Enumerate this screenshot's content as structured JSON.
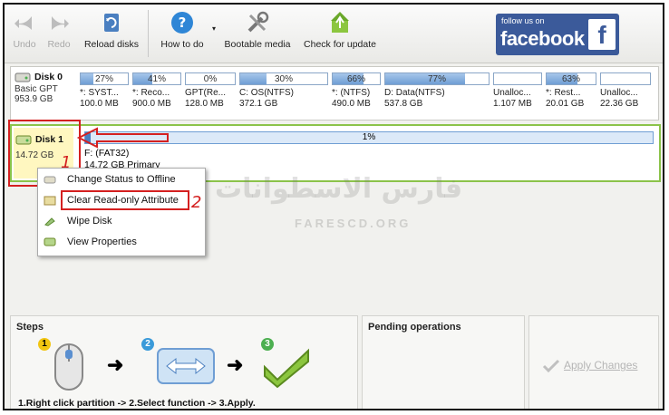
{
  "toolbar": {
    "undo": "Undo",
    "redo": "Redo",
    "reload": "Reload disks",
    "howto": "How to do",
    "bootable": "Bootable media",
    "update": "Check for update"
  },
  "facebook": {
    "small": "follow us on",
    "big": "facebook",
    "f": "f"
  },
  "disk0": {
    "name": "Disk 0",
    "type": "Basic GPT",
    "size": "953.9 GB",
    "partitions": [
      {
        "pct": "27%",
        "fill": 0.27,
        "name": "*: SYST...",
        "size": "100.0 MB"
      },
      {
        "pct": "41%",
        "fill": 0.41,
        "name": "*: Reco...",
        "size": "900.0 MB"
      },
      {
        "pct": "0%",
        "fill": 0.0,
        "name": "GPT(Re...",
        "size": "128.0 MB"
      },
      {
        "pct": "30%",
        "fill": 0.3,
        "name": "C: OS(NTFS)",
        "size": "372.1 GB"
      },
      {
        "pct": "66%",
        "fill": 0.66,
        "name": "*: (NTFS)",
        "size": "490.0 MB"
      },
      {
        "pct": "77%",
        "fill": 0.77,
        "name": "D: Data(NTFS)",
        "size": "537.8 GB"
      },
      {
        "pct": "",
        "fill": 0.0,
        "name": "Unalloc...",
        "size": "1.107 MB"
      },
      {
        "pct": "63%",
        "fill": 0.63,
        "name": "*: Rest...",
        "size": "20.01 GB"
      },
      {
        "pct": "",
        "fill": 0.0,
        "name": "Unalloc...",
        "size": "22.36 GB"
      }
    ]
  },
  "disk1": {
    "name": "Disk 1",
    "size": "14.72 GB",
    "pct": "1%",
    "fill": 0.01,
    "part_name": "F: (FAT32)",
    "part_size": "14.72 GB Primary"
  },
  "annotations": {
    "one": "1",
    "two": "2"
  },
  "context_menu": [
    "Change Status to Offline",
    "Clear Read-only Attribute",
    "Wipe Disk",
    "View Properties"
  ],
  "watermark": {
    "arabic": "فارس الاسطوانات",
    "latin": "FARESCD.ORG"
  },
  "steps": {
    "title": "Steps",
    "text": "1.Right click partition -> 2.Select function -> 3.Apply.",
    "badges": [
      "1",
      "2",
      "3"
    ]
  },
  "pending": {
    "title": "Pending operations"
  },
  "apply": {
    "label": "Apply Changes"
  }
}
